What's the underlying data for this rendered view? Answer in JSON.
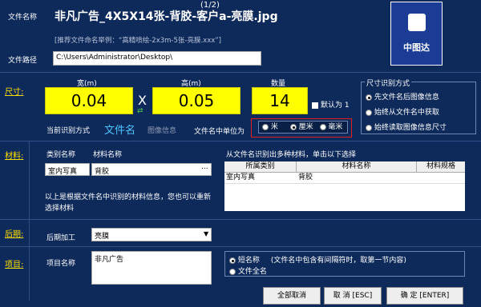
{
  "header": {
    "page_counter": "(1/2)",
    "filename_label": "文件名称",
    "filename": "非凡广告_4X5X14张-背胶-客户a-亮膜.jpg",
    "hint": "[推荐文件命名举例：“高精喷绘-2x3m-5张-亮膜.xxx”]",
    "path_label": "文件路径",
    "path": "C:\\Users\\Administrator\\Desktop\\"
  },
  "size": {
    "section": "尺寸:",
    "width_label": "宽(m)",
    "width": "0.04",
    "x": "X",
    "height_label": "高(m)",
    "height": "0.05",
    "qty_label": "数量",
    "qty": "14",
    "default1": "默认为 1",
    "mode_label": "当前识别方式",
    "mode_text": "文件名",
    "mode_alt": "图像信息",
    "unit_label": "文件名中单位为",
    "units": [
      "米",
      "厘米",
      "毫米"
    ]
  },
  "size_mode": {
    "title": "尺寸识别方式",
    "opts": [
      "先文件名后图像信息",
      "始终从文件名中获取",
      "始终读取图像信息尺寸"
    ]
  },
  "material": {
    "section": "材料:",
    "cat_label": "类别名称",
    "name_label": "材料名称",
    "cat": "室内写真",
    "name": "背胶",
    "more": "...",
    "note": "以上是根据文件名中识别的材料信息，您也可以重新选择材料",
    "multi_hint": "从文件名识别出多种材料，单击以下选择",
    "table_headers": [
      "所属类别",
      "材料名称",
      "材料规格"
    ],
    "table_row": [
      "室内写真",
      "背胶",
      ""
    ]
  },
  "post": {
    "section": "后期:",
    "label": "后期加工",
    "value": "亮膜"
  },
  "project": {
    "section": "项目:",
    "label": "项目名称",
    "value": "非凡广告",
    "short": "短名称",
    "short_note": "(文件名中包含有间隔符时，取第一节内容)",
    "full": "文件全名"
  },
  "buttons": {
    "cancel_all": "全部取消",
    "cancel": "取 消 [ESC]",
    "ok": "确 定 [ENTER]"
  },
  "colors": {
    "bg": "#0e2a5a",
    "accent": "#ffff00",
    "unit_border": "#e02020"
  }
}
